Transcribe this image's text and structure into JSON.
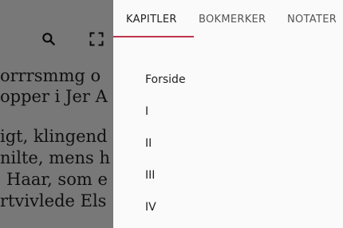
{
  "reader": {
    "toolbar": {
      "search_icon": "search-icon",
      "fullscreen_icon": "fullscreen-icon"
    },
    "text_lines": [
      "orrrsmmg o",
      "opper i Jer A",
      "igt, klingend",
      "nilte, mens h",
      "Haar, som e",
      "rtvivlede Els"
    ]
  },
  "panel": {
    "tabs": [
      {
        "label": "KAPITLER",
        "active": true
      },
      {
        "label": "BOKMERKER",
        "active": false
      },
      {
        "label": "NOTATER",
        "active": false
      }
    ],
    "accent_color": "#c0344c",
    "chapters": [
      "Forside",
      "I",
      "II",
      "III",
      "IV"
    ]
  }
}
